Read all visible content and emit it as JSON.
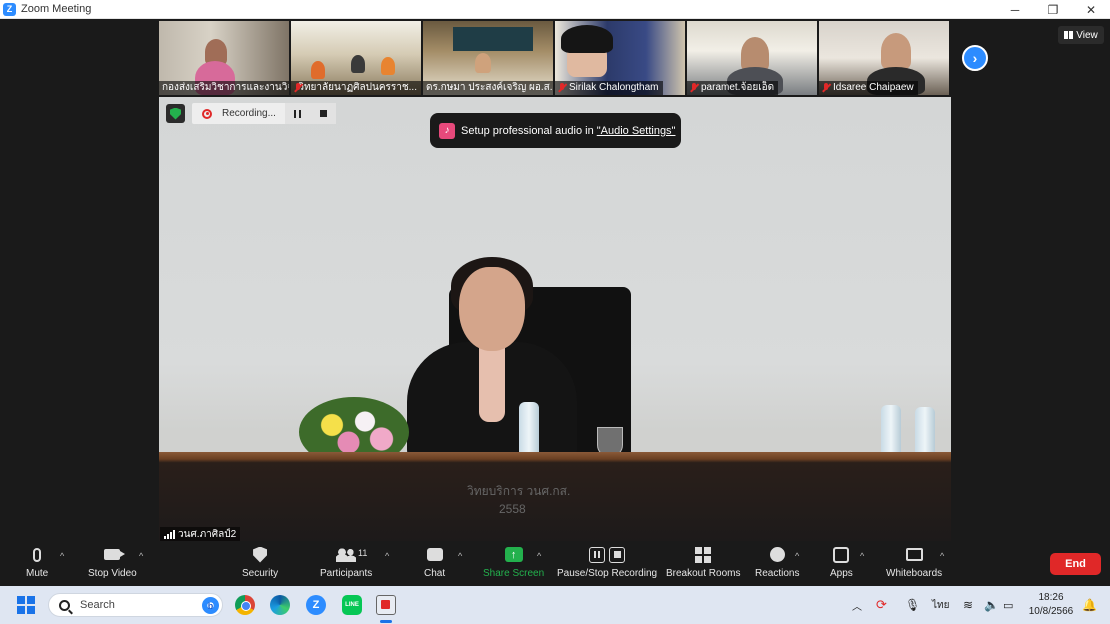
{
  "window": {
    "title": "Zoom Meeting",
    "icon": "Z"
  },
  "thumbnails": [
    {
      "name": "กองส่งเสริมวิชาการและงานวิจัย",
      "muted": false
    },
    {
      "name": "วิทยาลัยนาฏศิลปนครราช...",
      "muted": true
    },
    {
      "name": "ดร.กษมา ประสงค์เจริญ ผอ.ส...",
      "muted": false
    },
    {
      "name": "Sirilak Chalongtham",
      "muted": true
    },
    {
      "name": "paramet.จ้อยเอ็ด",
      "muted": true
    },
    {
      "name": "Idsaree Chaipaew",
      "muted": true
    }
  ],
  "view_button": {
    "label": "View"
  },
  "recording": {
    "label": "Recording..."
  },
  "audio_tooltip": {
    "text": "Setup professional audio in",
    "link": "\"Audio Settings\""
  },
  "main_video": {
    "speaker_name": "วนศ.ภาศิลป์2",
    "desk_text_1": "วิทยบริการ  วนศ.กส.",
    "desk_text_2": "2558"
  },
  "toolbar": {
    "mute": "Mute",
    "stop_video": "Stop Video",
    "security": "Security",
    "participants": "Participants",
    "participants_count": "11",
    "chat": "Chat",
    "share_screen": "Share Screen",
    "recording": "Pause/Stop Recording",
    "breakout": "Breakout Rooms",
    "reactions": "Reactions",
    "apps": "Apps",
    "whiteboards": "Whiteboards",
    "end": "End"
  },
  "taskbar": {
    "search_placeholder": "Search",
    "language": "ไทย",
    "time": "18:26",
    "date": "10/8/2566"
  },
  "colors": {
    "zoom_blue": "#2d8cff",
    "end_red": "#e02828",
    "share_green": "#23b14d",
    "toolbar_bg": "#1a1a1a",
    "taskbar_bg": "#dfe6f2"
  }
}
